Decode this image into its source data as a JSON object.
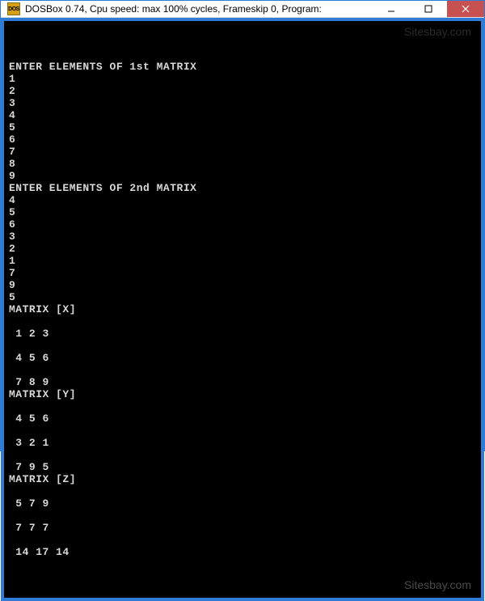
{
  "window": {
    "title": "DOSBox 0.74, Cpu speed: max 100% cycles, Frameskip 0, Program:",
    "icon_text": "DOS"
  },
  "watermark": {
    "top": "Sitesbay.com",
    "bottom": "Sitesbay.com"
  },
  "terminal": {
    "lines": [
      "ENTER ELEMENTS OF 1st MATRIX",
      "1",
      "2",
      "3",
      "4",
      "5",
      "6",
      "7",
      "8",
      "9",
      "ENTER ELEMENTS OF 2nd MATRIX",
      "4",
      "5",
      "6",
      "3",
      "2",
      "1",
      "7",
      "9",
      "5",
      "MATRIX [X]",
      "",
      " 1 2 3",
      "",
      " 4 5 6",
      "",
      " 7 8 9",
      "MATRIX [Y]",
      "",
      " 4 5 6",
      "",
      " 3 2 1",
      "",
      " 7 9 5",
      "MATRIX [Z]",
      "",
      " 5 7 9",
      "",
      " 7 7 7",
      "",
      " 14 17 14"
    ]
  },
  "chart_data": {
    "type": "table",
    "title": "Matrix Addition Program Output",
    "matrices": {
      "X": [
        [
          1,
          2,
          3
        ],
        [
          4,
          5,
          6
        ],
        [
          7,
          8,
          9
        ]
      ],
      "Y": [
        [
          4,
          5,
          6
        ],
        [
          3,
          2,
          1
        ],
        [
          7,
          9,
          5
        ]
      ],
      "Z": [
        [
          5,
          7,
          9
        ],
        [
          7,
          7,
          7
        ],
        [
          14,
          17,
          14
        ]
      ]
    },
    "input_sequence_1": [
      1,
      2,
      3,
      4,
      5,
      6,
      7,
      8,
      9
    ],
    "input_sequence_2": [
      4,
      5,
      6,
      3,
      2,
      1,
      7,
      9,
      5
    ]
  }
}
